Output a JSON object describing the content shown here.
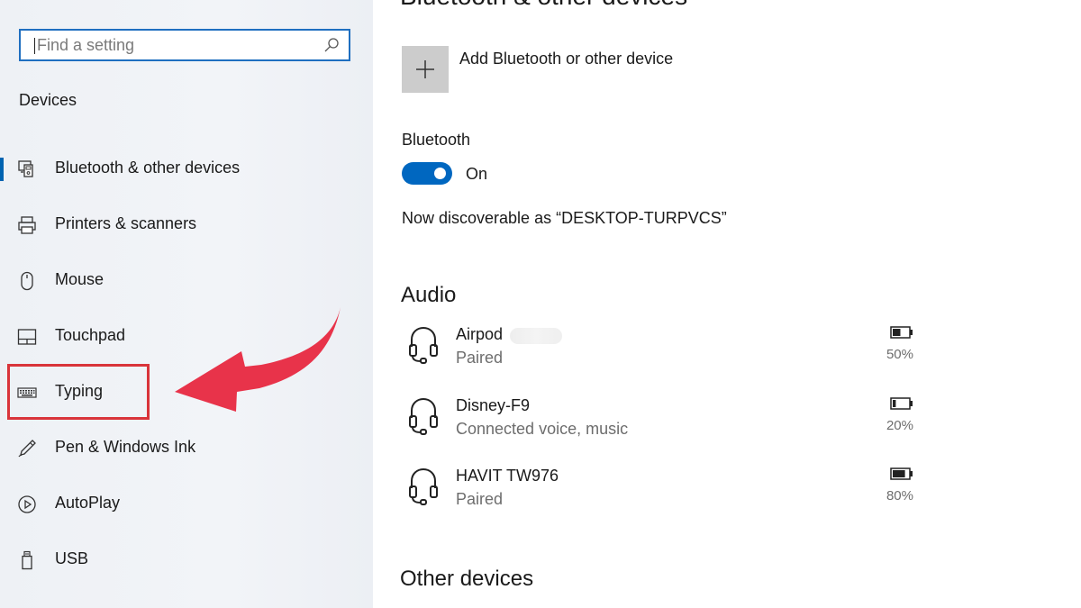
{
  "sidebar": {
    "search_placeholder": "Find a setting",
    "section_title": "Devices",
    "items": [
      {
        "label": "Bluetooth & other devices",
        "icon": "bluetooth-devices-icon",
        "selected": true
      },
      {
        "label": "Printers & scanners",
        "icon": "printer-icon"
      },
      {
        "label": "Mouse",
        "icon": "mouse-icon"
      },
      {
        "label": "Touchpad",
        "icon": "touchpad-icon"
      },
      {
        "label": "Typing",
        "icon": "keyboard-icon",
        "highlighted": true
      },
      {
        "label": "Pen & Windows Ink",
        "icon": "pen-icon"
      },
      {
        "label": "AutoPlay",
        "icon": "autoplay-icon"
      },
      {
        "label": "USB",
        "icon": "usb-icon"
      }
    ]
  },
  "main": {
    "title": "Bluetooth & other devices",
    "add_device_label": "Add Bluetooth or other device",
    "bluetooth_label": "Bluetooth",
    "bluetooth_state": "On",
    "discoverable_text": "Now discoverable as “DESKTOP-TURPVCS”",
    "audio_title": "Audio",
    "audio_devices": [
      {
        "name": "Airpod",
        "status": "Paired",
        "battery": "50%",
        "battery_level": 0.5
      },
      {
        "name": "Disney-F9",
        "status": "Connected voice, music",
        "battery": "20%",
        "battery_level": 0.2
      },
      {
        "name": "HAVIT TW976",
        "status": "Paired",
        "battery": "80%",
        "battery_level": 0.8
      }
    ],
    "other_devices_title": "Other devices"
  },
  "colors": {
    "accent": "#0067c0",
    "annotation_red": "#d9343a",
    "sidebar_bg": "#f0f2f6"
  }
}
